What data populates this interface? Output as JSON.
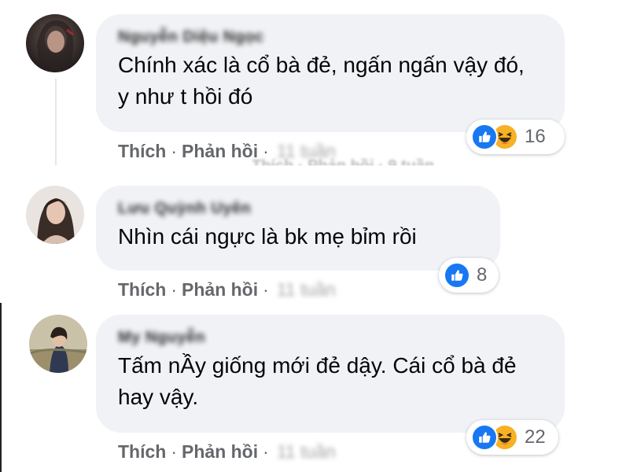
{
  "colors": {
    "bubble_bg": "#f0f2f5",
    "text": "#050505",
    "muted": "#65676b",
    "like_blue": "#1877f2",
    "haha_yellow": "#f7b125"
  },
  "comments": [
    {
      "author": "Nguyễn Diệu Ngọc",
      "text": "Chính xác là cổ bà đẻ, ngấn ngấn vậy đó, y như t hồi đó",
      "reactions": [
        "like-icon",
        "haha-icon"
      ],
      "reaction_count": "16",
      "like_label": "Thích",
      "reply_label": "Phản hồi",
      "separator": "·",
      "time": "11 tuần"
    },
    {
      "author": "Lưu Quỳnh Uyên",
      "text": "Nhìn cái ngực là bk mẹ bỉm rồi",
      "reactions": [
        "like-icon"
      ],
      "reaction_count": "8",
      "like_label": "Thích",
      "reply_label": "Phản hồi",
      "separator": "·",
      "time": "11 tuần"
    },
    {
      "author": "My Nguyễn",
      "text": "Tấm nẦy giống mới đẻ dậy. Cái cổ bà đẻ hay vậy.",
      "reactions": [
        "like-icon",
        "haha-icon"
      ],
      "reaction_count": "22",
      "like_label": "Thích",
      "reply_label": "Phản hồi",
      "separator": "·",
      "time": "11 tuần"
    }
  ],
  "ghost_row": {
    "like_label": "Thích",
    "separator": "·",
    "reply_label": "Phản hồi",
    "time": "9 tuần"
  }
}
